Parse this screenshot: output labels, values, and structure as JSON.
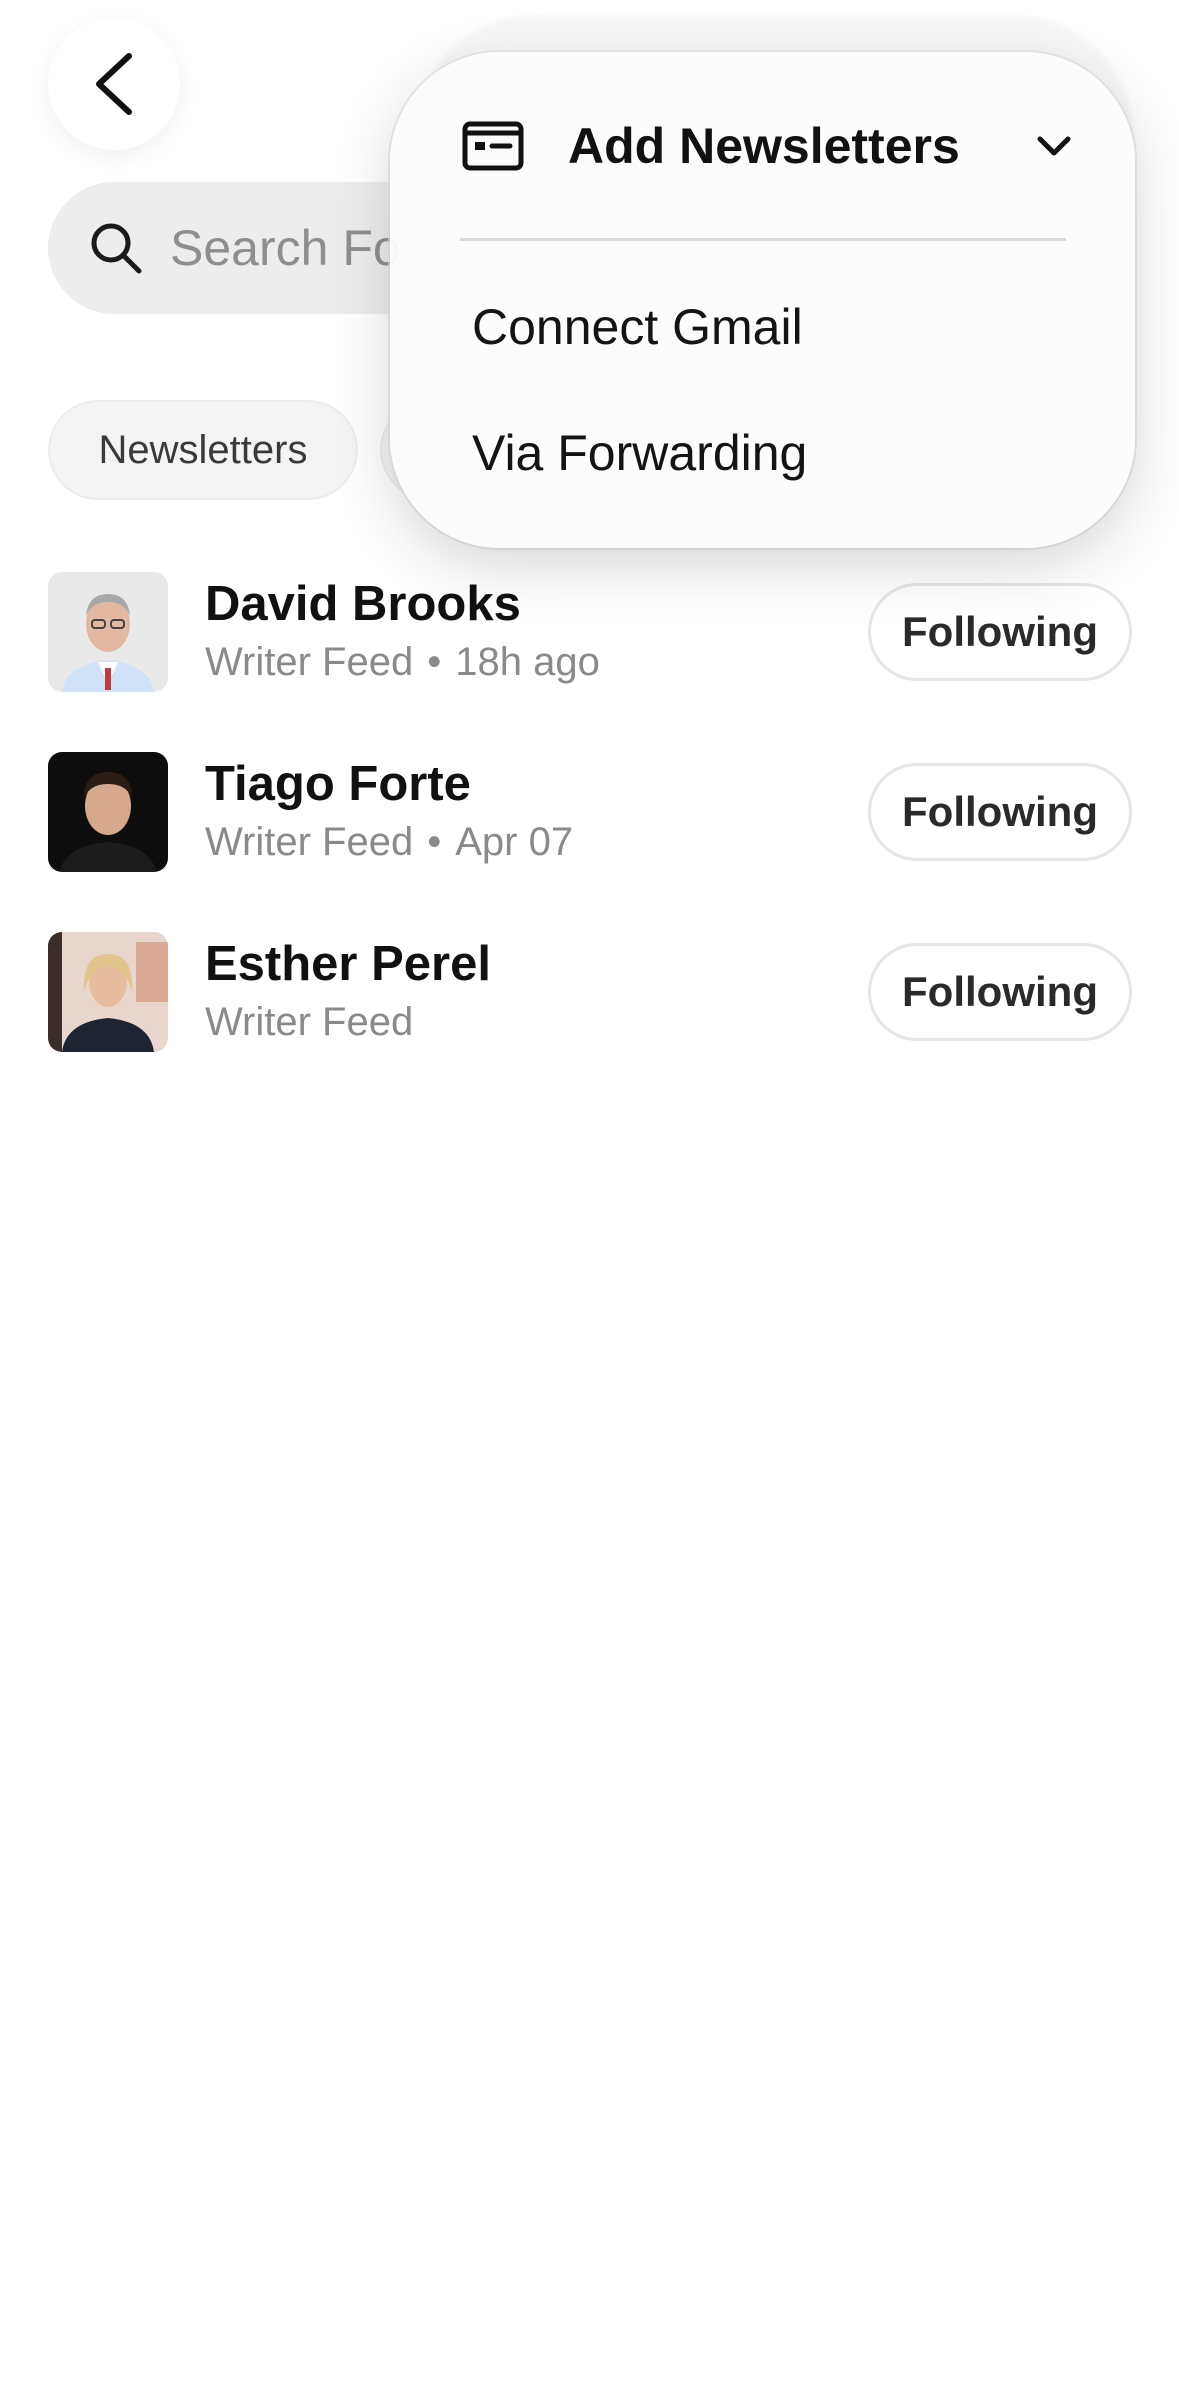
{
  "header": {
    "back_icon": "chevron-left-icon"
  },
  "search": {
    "placeholder": "Search Fo",
    "icon": "search-icon"
  },
  "filters": {
    "chips": [
      "Newsletters"
    ]
  },
  "feed": {
    "items": [
      {
        "name": "David Brooks",
        "source": "Writer Feed",
        "time": "18h ago",
        "button": "Following"
      },
      {
        "name": "Tiago Forte",
        "source": "Writer Feed",
        "time": "Apr 07",
        "button": "Following"
      },
      {
        "name": "Esther Perel",
        "source": "Writer Feed",
        "time": "",
        "button": "Following"
      }
    ]
  },
  "menu": {
    "title": "Add Newsletters",
    "icon": "newsletter-card-icon",
    "chevron": "chevron-down-icon",
    "items": [
      "Connect Gmail",
      "Via Forwarding"
    ]
  },
  "colors": {
    "background": "#ffffff",
    "search_bg": "#ededed",
    "muted_text": "#8a8a8a",
    "menu_bg": "#fcfcfc"
  }
}
